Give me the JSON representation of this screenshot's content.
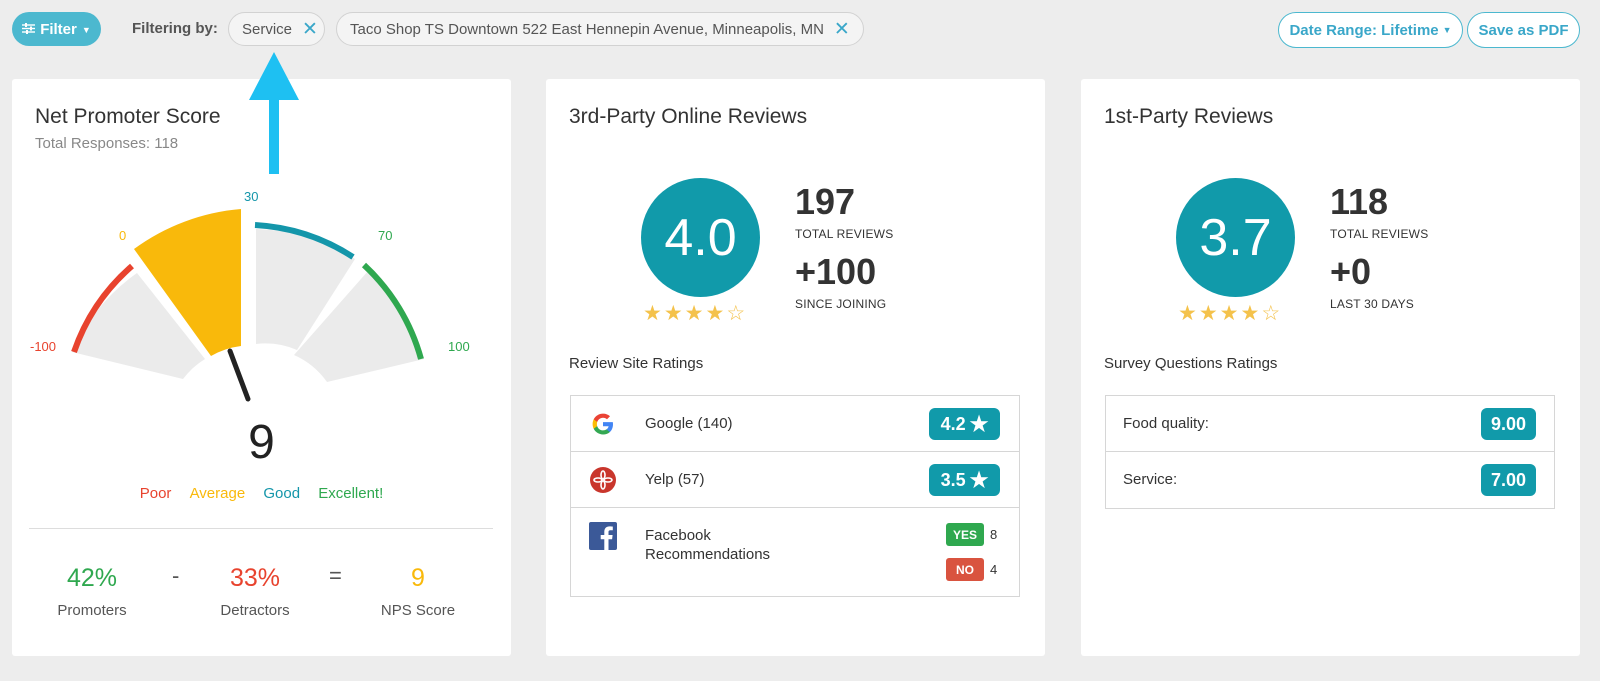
{
  "topbar": {
    "filter_label": "Filter",
    "filtering_by": "Filtering by:",
    "chips": [
      {
        "label": "Service"
      },
      {
        "label": "Taco Shop TS Downtown 522 East Hennepin Avenue, Minneapolis, MN"
      }
    ],
    "date_range_label": "Date Range: Lifetime",
    "save_pdf_label": "Save as PDF"
  },
  "nps": {
    "title": "Net Promoter Score",
    "subtitle": "Total Responses: 118",
    "gauge_labels": {
      "min": "-100",
      "zero": "0",
      "thirty": "30",
      "seventy": "70",
      "max": "100"
    },
    "score": 9,
    "score_text": "9",
    "legend": [
      "Poor",
      "Average",
      "Good",
      "Excellent!"
    ],
    "promoters_pct": "42%",
    "promoters_label": "Promoters",
    "minus": "-",
    "detractors_pct": "33%",
    "detractors_label": "Detractors",
    "equals": "=",
    "nps_value": "9",
    "nps_label": "NPS Score",
    "colors": {
      "poor": "#e8432e",
      "average": "#f9b90b",
      "good": "#1496aa",
      "excellent": "#2fa84f"
    }
  },
  "third_party": {
    "title": "3rd-Party Online Reviews",
    "rating": "4.0",
    "stars_filled": 4,
    "stars_total": 5,
    "total_reviews": "197",
    "total_reviews_label": "TOTAL REVIEWS",
    "since_joining": "+100",
    "since_joining_label": "SINCE JOINING",
    "section_label": "Review Site Ratings",
    "sites": [
      {
        "name": "Google (140)",
        "rating": "4.2",
        "icon": "google-icon"
      },
      {
        "name": "Yelp (57)",
        "rating": "3.5",
        "icon": "yelp-icon"
      }
    ],
    "facebook": {
      "name_line1": "Facebook",
      "name_line2": "Recommendations",
      "yes_label": "YES",
      "yes_count": "8",
      "no_label": "NO",
      "no_count": "4",
      "icon": "facebook-icon"
    }
  },
  "first_party": {
    "title": "1st-Party Reviews",
    "rating": "3.7",
    "stars_filled": 4,
    "stars_total": 5,
    "total_reviews": "118",
    "total_reviews_label": "TOTAL REVIEWS",
    "last_30": "+0",
    "last_30_label": "LAST 30 DAYS",
    "section_label": "Survey Questions Ratings",
    "questions": [
      {
        "name": "Food quality:",
        "rating": "9.00"
      },
      {
        "name": "Service:",
        "rating": "7.00"
      }
    ]
  },
  "colors": {
    "accent": "#4cb8cf",
    "teal": "#119aaa",
    "star": "#f4c24b",
    "yes": "#2fa84f",
    "no": "#d9533f",
    "arrow": "#1ec0f2"
  }
}
